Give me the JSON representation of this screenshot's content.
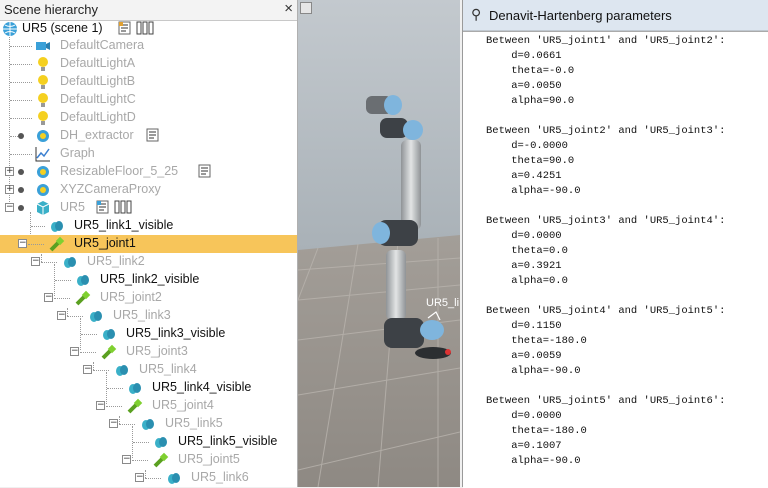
{
  "hierarchy": {
    "title": "Scene hierarchy",
    "close": "×",
    "items": [
      {
        "label": "UR5 (scene 1)"
      },
      {
        "label": "DefaultCamera"
      },
      {
        "label": "DefaultLightA"
      },
      {
        "label": "DefaultLightB"
      },
      {
        "label": "DefaultLightC"
      },
      {
        "label": "DefaultLightD"
      },
      {
        "label": "DH_extractor"
      },
      {
        "label": "Graph"
      },
      {
        "label": "ResizableFloor_5_25"
      },
      {
        "label": "XYZCameraProxy"
      },
      {
        "label": "UR5"
      },
      {
        "label": "UR5_link1_visible"
      },
      {
        "label": "UR5_joint1"
      },
      {
        "label": "UR5_link2"
      },
      {
        "label": "UR5_link2_visible"
      },
      {
        "label": "UR5_joint2"
      },
      {
        "label": "UR5_link3"
      },
      {
        "label": "UR5_link3_visible"
      },
      {
        "label": "UR5_joint3"
      },
      {
        "label": "UR5_link4"
      },
      {
        "label": "UR5_link4_visible"
      },
      {
        "label": "UR5_joint4"
      },
      {
        "label": "UR5_link5"
      },
      {
        "label": "UR5_link5_visible"
      },
      {
        "label": "UR5_joint5"
      },
      {
        "label": "UR5_link6"
      }
    ],
    "selected_color": "#f7c55a"
  },
  "viewport": {
    "overlay_label": "UR5_li"
  },
  "dh_window": {
    "title": "Denavit-Hartenberg parameters",
    "lines": [
      "Between 'UR5_joint1' and 'UR5_joint2':",
      "    d=0.0661",
      "    theta=-0.0",
      "    a=0.0050",
      "    alpha=90.0",
      "",
      "Between 'UR5_joint2' and 'UR5_joint3':",
      "    d=-0.0000",
      "    theta=90.0",
      "    a=0.4251",
      "    alpha=-90.0",
      "",
      "Between 'UR5_joint3' and 'UR5_joint4':",
      "    d=0.0000",
      "    theta=0.0",
      "    a=0.3921",
      "    alpha=0.0",
      "",
      "Between 'UR5_joint4' and 'UR5_joint5':",
      "    d=0.1150",
      "    theta=-180.0",
      "    a=0.0059",
      "    alpha=-90.0",
      "",
      "Between 'UR5_joint5' and 'UR5_joint6':",
      "    d=0.0000",
      "    theta=-180.0",
      "    a=0.1007",
      "    alpha=-90.0"
    ]
  }
}
